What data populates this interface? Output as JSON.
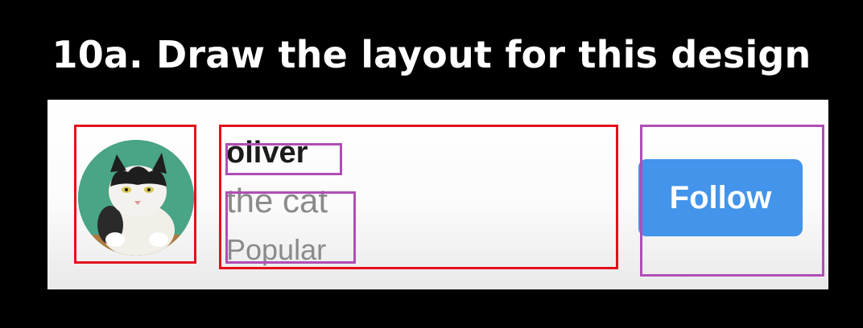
{
  "heading": "10a. Draw the layout for this design",
  "profile": {
    "name": "oliver",
    "subtitle": "the cat",
    "tag": "Popular",
    "avatar_icon": "cat-avatar-icon"
  },
  "actions": {
    "follow_label": "Follow"
  },
  "colors": {
    "layout_box_red": "#e3101c",
    "layout_box_purple": "#b04db6",
    "follow_button": "#4394ea",
    "avatar_background": "#4aa486"
  }
}
